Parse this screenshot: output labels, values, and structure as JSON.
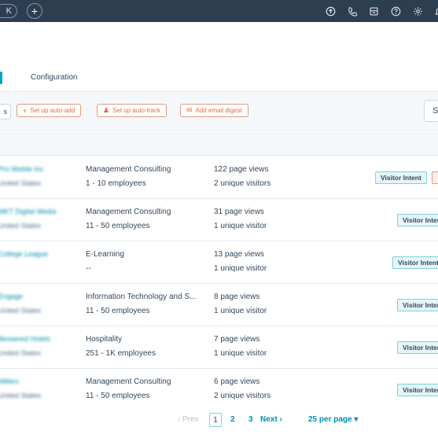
{
  "topbar": {
    "app_badge": "K",
    "add_label": "+",
    "icons": [
      "upgrade-icon",
      "phone-icon",
      "marketplace-icon",
      "help-icon",
      "settings-icon",
      "notifications-icon"
    ]
  },
  "tabs": {
    "config_label": "Configuration"
  },
  "toolbar": {
    "left_label": "s",
    "auto_add_label": "Set up auto-add",
    "auto_track_label": "Set up auto-track",
    "digest_label": "Add email digest",
    "search_label": "S"
  },
  "rows": [
    {
      "company": "Pro Mobile Inc",
      "country": "United States",
      "industry": "Management Consulting",
      "size": "1 - 10 employees",
      "views": "122 page views",
      "visitors": "2 unique visitors",
      "intent": "Visitor Intent"
    },
    {
      "company": "MKT Digital Media",
      "country": "United States",
      "industry": "Management Consulting",
      "size": "11 - 50 employees",
      "views": "31 page views",
      "visitors": "1 unique visitor",
      "intent": "Visitor Intent"
    },
    {
      "company": "College League",
      "country": "",
      "industry": "E-Learning",
      "size": "--",
      "views": "13 page views",
      "visitors": "1 unique visitor",
      "intent": "Visitor Intent"
    },
    {
      "company": "Engage",
      "country": "United States",
      "industry": "Information Technology and S...",
      "size": "11 - 50 employees",
      "views": "8 page views",
      "visitors": "1 unique visitor",
      "intent": "Visitor Intent"
    },
    {
      "company": "Bessered Hotels",
      "country": "United States",
      "industry": "Hospitality",
      "size": "251 - 1K employees",
      "views": "7 page views",
      "visitors": "1 unique visitor",
      "intent": "Visitor Intent"
    },
    {
      "company": "Millers",
      "country": "United States",
      "industry": "Management Consulting",
      "size": "11 - 50 employees",
      "views": "6 page views",
      "visitors": "2 unique visitors",
      "intent": "Visitor Intent"
    }
  ],
  "pagination": {
    "prev": "‹  Prev",
    "pages": [
      "1",
      "2",
      "3"
    ],
    "next": "Next  ›",
    "per_page": "25 per page ▾"
  },
  "colors": {
    "nav_bg": "#2d3e50",
    "accent": "#00a4bd",
    "orange": "#e06f44",
    "link": "#0091ae"
  }
}
